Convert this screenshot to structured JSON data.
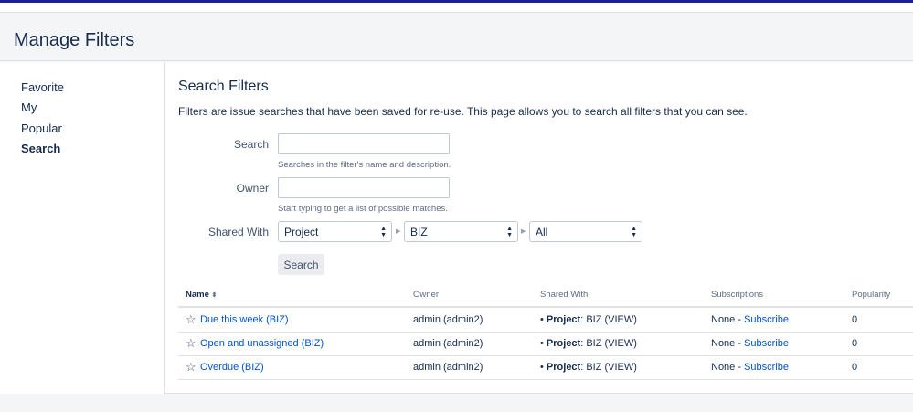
{
  "header": {
    "title": "Manage Filters"
  },
  "sidebar": {
    "items": [
      {
        "label": "Favorite",
        "active": false
      },
      {
        "label": "My",
        "active": false
      },
      {
        "label": "Popular",
        "active": false
      },
      {
        "label": "Search",
        "active": true
      }
    ]
  },
  "main": {
    "title": "Search Filters",
    "description": "Filters are issue searches that have been saved for re-use. This page allows you to search all filters that you can see.",
    "search": {
      "label": "Search",
      "value": "",
      "hint": "Searches in the filter's name and description."
    },
    "owner": {
      "label": "Owner",
      "value": "",
      "hint": "Start typing to get a list of possible matches."
    },
    "shared_with": {
      "label": "Shared With",
      "type": "Project",
      "project": "BIZ",
      "role": "All"
    },
    "search_button": "Search"
  },
  "table": {
    "headers": {
      "name": "Name",
      "sort_icon": "sort-icon",
      "owner": "Owner",
      "shared": "Shared With",
      "subscriptions": "Subscriptions",
      "popularity": "Popularity"
    },
    "rows": [
      {
        "name": "Due this week (BIZ)",
        "owner": "admin (admin2)",
        "shared_type": "Project",
        "shared_value": ": BIZ (VIEW)",
        "sub_none": "None - ",
        "sub_link": "Subscribe",
        "popularity": "0"
      },
      {
        "name": "Open and unassigned (BIZ)",
        "owner": "admin (admin2)",
        "shared_type": "Project",
        "shared_value": ": BIZ (VIEW)",
        "sub_none": "None - ",
        "sub_link": "Subscribe",
        "popularity": "0"
      },
      {
        "name": "Overdue (BIZ)",
        "owner": "admin (admin2)",
        "shared_type": "Project",
        "shared_value": ": BIZ (VIEW)",
        "sub_none": "None - ",
        "sub_link": "Subscribe",
        "popularity": "0"
      }
    ]
  },
  "colors": {
    "accent": "#0052cc",
    "topbar": "#1a1f9c",
    "text": "#172b4d"
  }
}
